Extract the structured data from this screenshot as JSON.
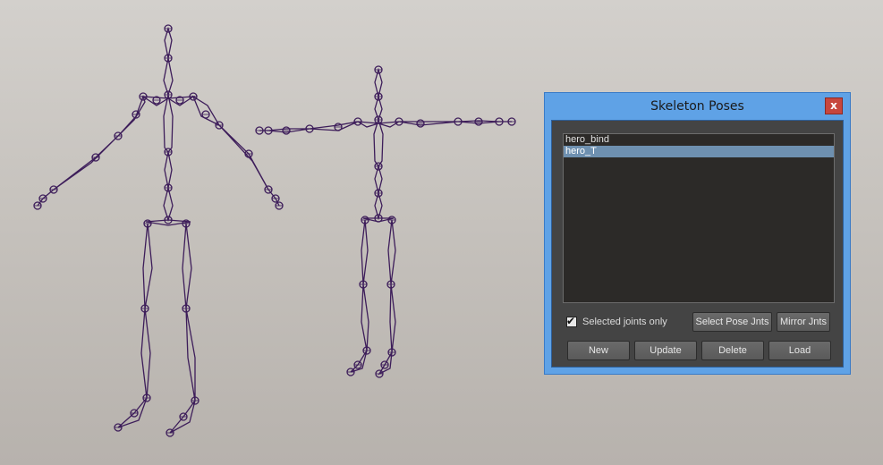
{
  "dialog": {
    "title": "Skeleton Poses",
    "close_label": "x",
    "poses": [
      {
        "name": "hero_bind",
        "selected": false
      },
      {
        "name": "hero_T",
        "selected": true
      }
    ],
    "selected_joints_only": {
      "label": "Selected joints only",
      "checked": true
    },
    "buttons": {
      "select_pose_jnts": "Select Pose Jnts",
      "mirror_jnts": "Mirror Jnts",
      "new": "New",
      "update": "Update",
      "delete": "Delete",
      "load": "Load"
    }
  },
  "viewport": {
    "objects": [
      "skeleton-hero-bind",
      "skeleton-hero-t"
    ],
    "wire_color": "#3d1d5a",
    "background_color": "#c9c5c0"
  },
  "colors": {
    "dialog_frame": "#5fa2e6",
    "list_selection": "#6e90b0",
    "close_button": "#c7463d"
  }
}
